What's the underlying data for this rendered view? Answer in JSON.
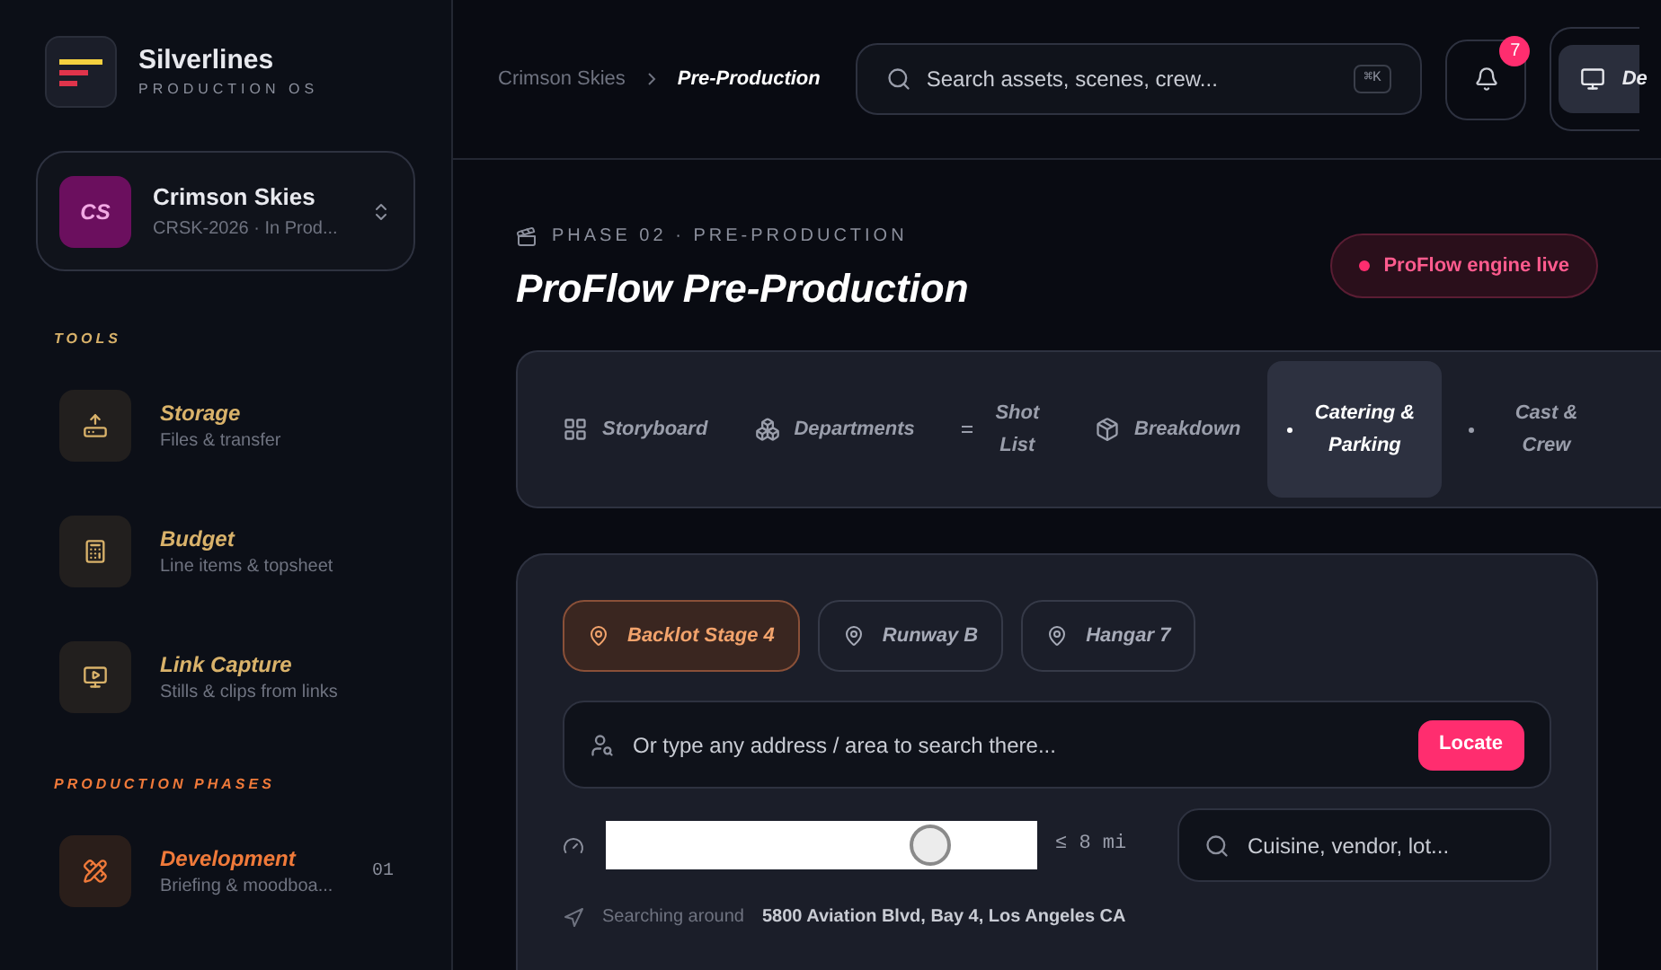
{
  "brand": {
    "name": "Silverlines",
    "tagline": "PRODUCTION OS"
  },
  "project": {
    "initials": "CS",
    "name": "Crimson Skies",
    "meta": "CRSK-2026 · In Prod..."
  },
  "tools": {
    "heading": "TOOLS",
    "items": [
      {
        "kind": "storage",
        "title": "Storage",
        "subtitle": "Files & transfer"
      },
      {
        "kind": "budget",
        "title": "Budget",
        "subtitle": "Line items & topsheet"
      },
      {
        "kind": "capture",
        "title": "Link Capture",
        "subtitle": "Stills & clips from links"
      }
    ]
  },
  "phases": {
    "heading": "PRODUCTION PHASES",
    "items": [
      {
        "kind": "development",
        "title": "Development",
        "subtitle": "Briefing & moodboa...",
        "number": "01"
      }
    ]
  },
  "breadcrumb": [
    "Crimson Skies",
    "Pre-Production"
  ],
  "search": {
    "placeholder": "Search assets, scenes, crew...",
    "shortcut": "⌘K"
  },
  "notifications": {
    "count": "7"
  },
  "view_button": {
    "label": "De"
  },
  "eyebrow": "PHASE 02 · PRE-PRODUCTION",
  "title": "ProFlow Pre-Production",
  "status": {
    "label": "ProFlow engine live"
  },
  "tabs": [
    {
      "kind": "grid",
      "label": "Storyboard",
      "selected": false
    },
    {
      "kind": "cluster",
      "label": "Departments",
      "selected": false
    },
    {
      "kind": "lines",
      "label": "Shot List",
      "selected": false
    },
    {
      "kind": "box",
      "label": "Breakdown",
      "selected": false
    },
    {
      "kind": "dot",
      "label": "Catering & Parking",
      "selected": true
    },
    {
      "kind": "dot",
      "label": "Cast & Crew",
      "selected": false
    }
  ],
  "locations": [
    {
      "label": "Backlot Stage 4",
      "selected": true
    },
    {
      "label": "Runway B",
      "selected": false
    },
    {
      "label": "Hangar 7",
      "selected": false
    }
  ],
  "address": {
    "placeholder": "Or type any address / area to search there...",
    "button": "Locate"
  },
  "radius": {
    "level": 0.75,
    "reading": "≤ 8 mi"
  },
  "vendor_search": {
    "placeholder": "Cuisine, vendor, lot..."
  },
  "searching": {
    "label": "Searching around",
    "address": "5800 Aviation Blvd, Bay 4, Los Angeles CA"
  }
}
